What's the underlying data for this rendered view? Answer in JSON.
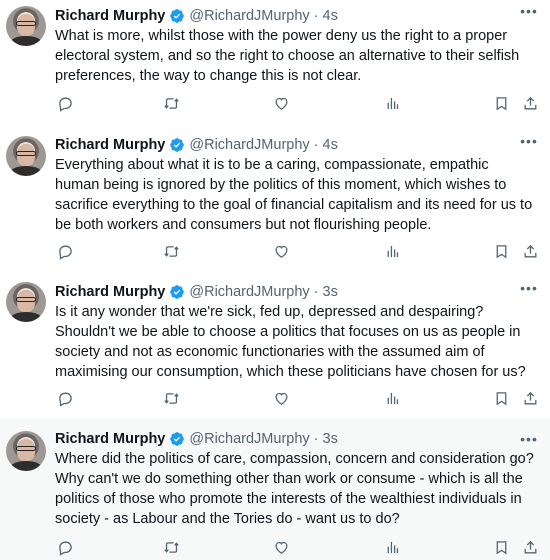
{
  "tweets": [
    {
      "name": "Richard Murphy",
      "handle": "@RichardJMurphy",
      "time": "4s",
      "lines": [
        "What is more, whilst those with the power deny us the right to a proper",
        "electoral system, and so the right to choose an alternative to their selfish",
        "preferences, the way to change this is not clear."
      ]
    },
    {
      "name": "Richard Murphy",
      "handle": "@RichardJMurphy",
      "time": "4s",
      "lines": [
        "Everything about what it is to be a caring, compassionate, empathic",
        "human being is ignored by the politics of this moment, which wishes to",
        "sacrifice everything to the goal of financial capitalism and its need for us to",
        "be both workers and consumers but not flourishing people."
      ]
    },
    {
      "name": "Richard Murphy",
      "handle": "@RichardJMurphy",
      "time": "3s",
      "lines": [
        "Is it any wonder that we're sick, fed up, depressed and despairing?",
        "Shouldn't we be able to choose a politics that focuses on us as people in",
        "society and not as economic functionaries with the assumed aim of",
        "maximising our consumption, which these politicians have chosen for us?"
      ]
    },
    {
      "name": "Richard Murphy",
      "handle": "@RichardJMurphy",
      "time": "3s",
      "lines": [
        "Where did the politics of care, compassion, concern and consideration go?",
        "Why can't we do something other than work or consume - which is all the",
        "politics of those who promote the interests of the wealthiest individuals in",
        "society - as Labour and the Tories do - want us to do?"
      ]
    }
  ],
  "icons": {
    "verified_color": "#1d9bf0",
    "action_color": "#536471",
    "more": "more-icon",
    "reply": "reply-icon",
    "retweet": "retweet-icon",
    "like": "like-icon",
    "views": "views-icon",
    "bookmark": "bookmark-icon",
    "share": "share-icon"
  },
  "separator": "·",
  "more_glyph": "•••"
}
